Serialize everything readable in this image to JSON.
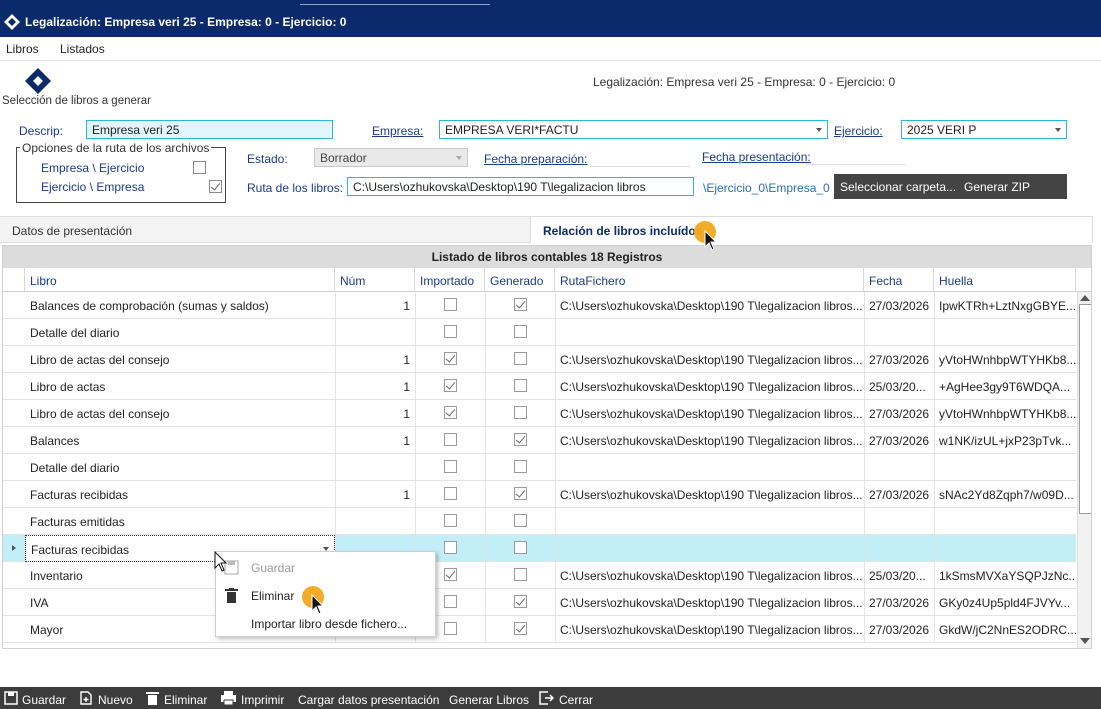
{
  "window": {
    "title": "Legalización: Empresa veri 25 - Empresa: 0 - Ejercicio: 0"
  },
  "menu": {
    "libros": "Libros",
    "listados": "Listados"
  },
  "header": {
    "caption": "Legalización: Empresa veri 25 - Empresa: 0 - Ejercicio: 0",
    "section": "Selección de libros a generar"
  },
  "form": {
    "descrip_label": "Descrip:",
    "descrip_value": "Empresa veri 25",
    "empresa_label": "Empresa:",
    "empresa_value": "EMPRESA VERI*FACTU",
    "ejercicio_label": "Ejercicio:",
    "ejercicio_value": "2025 VERI P",
    "options_group_title": "Opciones de la ruta de los archivos",
    "opt1_label": "Empresa \\ Ejercicio",
    "opt1_checked": false,
    "opt2_label": "Ejercicio \\ Empresa",
    "opt2_checked": true,
    "estado_label": "Estado:",
    "estado_value": "Borrador",
    "fecha_prep_label": "Fecha preparación:",
    "fecha_pres_label": "Fecha presentación:",
    "ruta_label": "Ruta de los libros:",
    "ruta_value": "C:\\Users\\ozhukovska\\Desktop\\190 T\\legalizacion libros",
    "ruta_suffix": "\\Ejercicio_0\\Empresa_0",
    "select_folder_button": "Seleccionar carpeta...",
    "zip_button": "Generar ZIP"
  },
  "tabs": [
    {
      "label": "Datos de presentación",
      "active": false
    },
    {
      "label": "Relación de libros incluídos",
      "active": true
    }
  ],
  "grid": {
    "caption": "Listado de libros contables 18 Registros",
    "columns": [
      "Libro",
      "Núm",
      "Importado",
      "Generado",
      "RutaFichero",
      "Fecha",
      "Huella"
    ],
    "rows": [
      {
        "libro": "Balances de comprobación (sumas y saldos)",
        "num": "1",
        "importado": false,
        "generado": true,
        "ruta": "C:\\Users\\ozhukovska\\Desktop\\190 T\\legalizacion libros...",
        "fecha": "27/03/2026",
        "huella": "IpwKTRh+LztNxgGBYE..."
      },
      {
        "libro": "Detalle del diario",
        "num": "",
        "importado": false,
        "generado": false,
        "ruta": "",
        "fecha": "",
        "huella": ""
      },
      {
        "libro": "Libro de actas del consejo",
        "num": "1",
        "importado": true,
        "generado": false,
        "ruta": "C:\\Users\\ozhukovska\\Desktop\\190 T\\legalizacion libros...",
        "fecha": "27/03/2026",
        "huella": "yVtoHWnhbpWTYHKb8..."
      },
      {
        "libro": "Libro de actas",
        "num": "1",
        "importado": true,
        "generado": false,
        "ruta": "C:\\Users\\ozhukovska\\Desktop\\190 T\\legalizacion libros...",
        "fecha": "25/03/20...",
        "huella": "+AgHee3gy9T6WDQA..."
      },
      {
        "libro": "Libro de actas del consejo",
        "num": "1",
        "importado": true,
        "generado": false,
        "ruta": "C:\\Users\\ozhukovska\\Desktop\\190 T\\legalizacion libros...",
        "fecha": "27/03/2026",
        "huella": "yVtoHWnhbpWTYHKb8..."
      },
      {
        "libro": "Balances",
        "num": "1",
        "importado": false,
        "generado": true,
        "ruta": "C:\\Users\\ozhukovska\\Desktop\\190 T\\legalizacion libros...",
        "fecha": "27/03/2026",
        "huella": "w1NK/izUL+jxP23pTvk..."
      },
      {
        "libro": "Detalle del diario",
        "num": "",
        "importado": false,
        "generado": false,
        "ruta": "",
        "fecha": "",
        "huella": ""
      },
      {
        "libro": "Facturas recibidas",
        "num": "1",
        "importado": false,
        "generado": true,
        "ruta": "C:\\Users\\ozhukovska\\Desktop\\190 T\\legalizacion libros...",
        "fecha": "27/03/2026",
        "huella": "sNAc2Yd8Zqph7/w09D..."
      },
      {
        "libro": "Facturas emitidas",
        "num": "",
        "importado": false,
        "generado": false,
        "ruta": "",
        "fecha": "",
        "huella": ""
      },
      {
        "libro": "Facturas recibidas",
        "num": "",
        "importado": false,
        "generado": false,
        "ruta": "",
        "fecha": "",
        "huella": "",
        "selected": true
      },
      {
        "libro": "Inventario",
        "num": "",
        "importado": true,
        "generado": false,
        "ruta": "C:\\Users\\ozhukovska\\Desktop\\190 T\\legalizacion libros...",
        "fecha": "25/03/20...",
        "huella": "1kSmsMVXaYSQPJzNc..."
      },
      {
        "libro": "IVA",
        "num": "",
        "importado": false,
        "generado": true,
        "ruta": "C:\\Users\\ozhukovska\\Desktop\\190 T\\legalizacion libros...",
        "fecha": "27/03/2026",
        "huella": "GKy0z4Up5pld4FJVYv..."
      },
      {
        "libro": "Mayor",
        "num": "",
        "importado": false,
        "generado": true,
        "ruta": "C:\\Users\\ozhukovska\\Desktop\\190 T\\legalizacion libros...",
        "fecha": "27/03/2026",
        "huella": "GkdW/jC2NnES2ODRC..."
      }
    ]
  },
  "context_menu": {
    "guardar": "Guardar",
    "eliminar": "Eliminar",
    "importar": "Importar libro desde fichero..."
  },
  "bottom": {
    "guardar": "Guardar",
    "nuevo": "Nuevo",
    "eliminar": "Eliminar",
    "imprimir": "Imprimir",
    "cargar": "Cargar datos presentación",
    "generar": "Generar Libros",
    "cerrar": "Cerrar"
  },
  "colors": {
    "titlebar": "#0b2a6b",
    "accent": "#2bb6d6",
    "highlight": "#f3a81c",
    "selected_row": "#c2eef8"
  },
  "icons": [
    "app-logo-icon",
    "save-icon",
    "new-icon",
    "trash-icon",
    "print-icon",
    "exit-icon",
    "cursor-icon",
    "chevron-down-icon"
  ]
}
